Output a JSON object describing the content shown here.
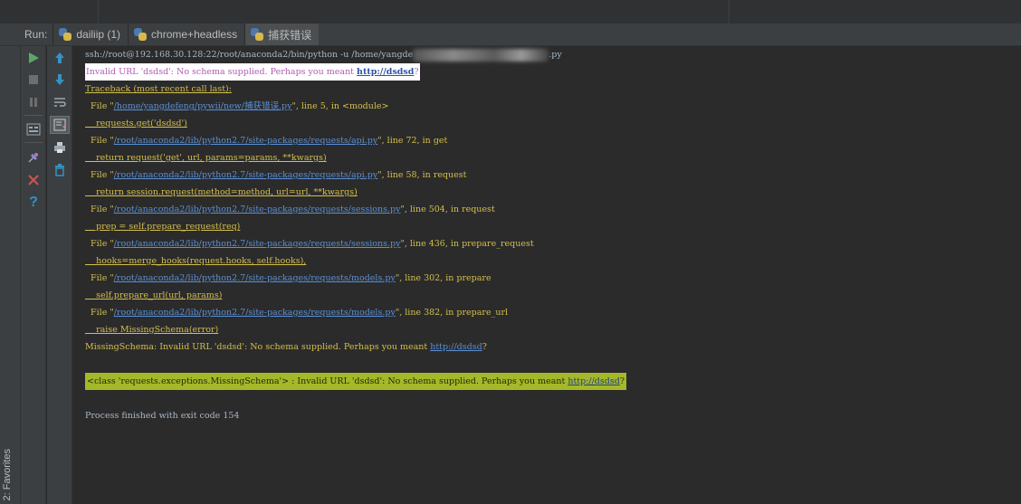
{
  "run": {
    "label": "Run:",
    "tabs": [
      {
        "label": "dailiip (1)",
        "closable": true
      },
      {
        "label": "chrome+headless",
        "closable": true
      },
      {
        "label": "捕获错误",
        "closable": false
      }
    ]
  },
  "favorites_label": "2: Favorites",
  "console": {
    "cmd_start": "ssh://root@192.168.30.128:22/root/anaconda2/bin/python -u /home/yangde",
    "cmd_end": ".py",
    "warn_text": "Invalid URL 'dsdsd': No schema supplied. Perhaps you meant ",
    "warn_link": "http://dsdsd",
    "warn_end": "?",
    "traceback": "Traceback (most recent call last):",
    "frames": [
      {
        "pre": "  File \"",
        "path": "/home/yangdefeng/pywii/new/捕获错误.py",
        "post": "\", line 5, in <module>"
      },
      {
        "code": "    requests.get('dsdsd')"
      },
      {
        "pre": "  File \"",
        "path": "/root/anaconda2/lib/python2.7/site-packages/requests/api.py",
        "post": "\", line 72, in get"
      },
      {
        "code": "    return request('get', url, params=params, **kwargs)"
      },
      {
        "pre": "  File \"",
        "path": "/root/anaconda2/lib/python2.7/site-packages/requests/api.py",
        "post": "\", line 58, in request"
      },
      {
        "code": "    return session.request(method=method, url=url, **kwargs)"
      },
      {
        "pre": "  File \"",
        "path": "/root/anaconda2/lib/python2.7/site-packages/requests/sessions.py",
        "post": "\", line 504, in request"
      },
      {
        "code": "    prep = self.prepare_request(req)"
      },
      {
        "pre": "  File \"",
        "path": "/root/anaconda2/lib/python2.7/site-packages/requests/sessions.py",
        "post": "\", line 436, in prepare_request"
      },
      {
        "code": "    hooks=merge_hooks(request.hooks, self.hooks),"
      },
      {
        "pre": "  File \"",
        "path": "/root/anaconda2/lib/python2.7/site-packages/requests/models.py",
        "post": "\", line 302, in prepare"
      },
      {
        "code": "    self.prepare_url(url, params)"
      },
      {
        "pre": "  File \"",
        "path": "/root/anaconda2/lib/python2.7/site-packages/requests/models.py",
        "post": "\", line 382, in prepare_url"
      },
      {
        "code": "    raise MissingSchema(error)"
      }
    ],
    "missing_text": "MissingSchema: Invalid URL 'dsdsd': No schema supplied. Perhaps you meant ",
    "missing_link": "http://dsdsd",
    "missing_end": "?",
    "class_text": "<class 'requests.exceptions.MissingSchema'> : Invalid URL 'dsdsd': No schema supplied. Perhaps you meant ",
    "class_link": "http://dsdsd",
    "class_end": "?",
    "exit_text": "Process finished with exit code 154"
  },
  "icons": {
    "col1": [
      "play-icon",
      "stop-icon",
      "pause-icon",
      "layout-icon",
      "pin-icon",
      "close-icon",
      "help-icon"
    ],
    "col2": [
      "arrow-up-icon",
      "arrow-down-icon",
      "soft-wrap-icon",
      "scroll-to-end-icon",
      "print-icon",
      "trash-icon"
    ]
  },
  "colors": {
    "error_text": "#d4bf4c",
    "link": "#5a90d6",
    "highlight_green": "#a5b82a",
    "warn_purple": "#b25bb1"
  }
}
